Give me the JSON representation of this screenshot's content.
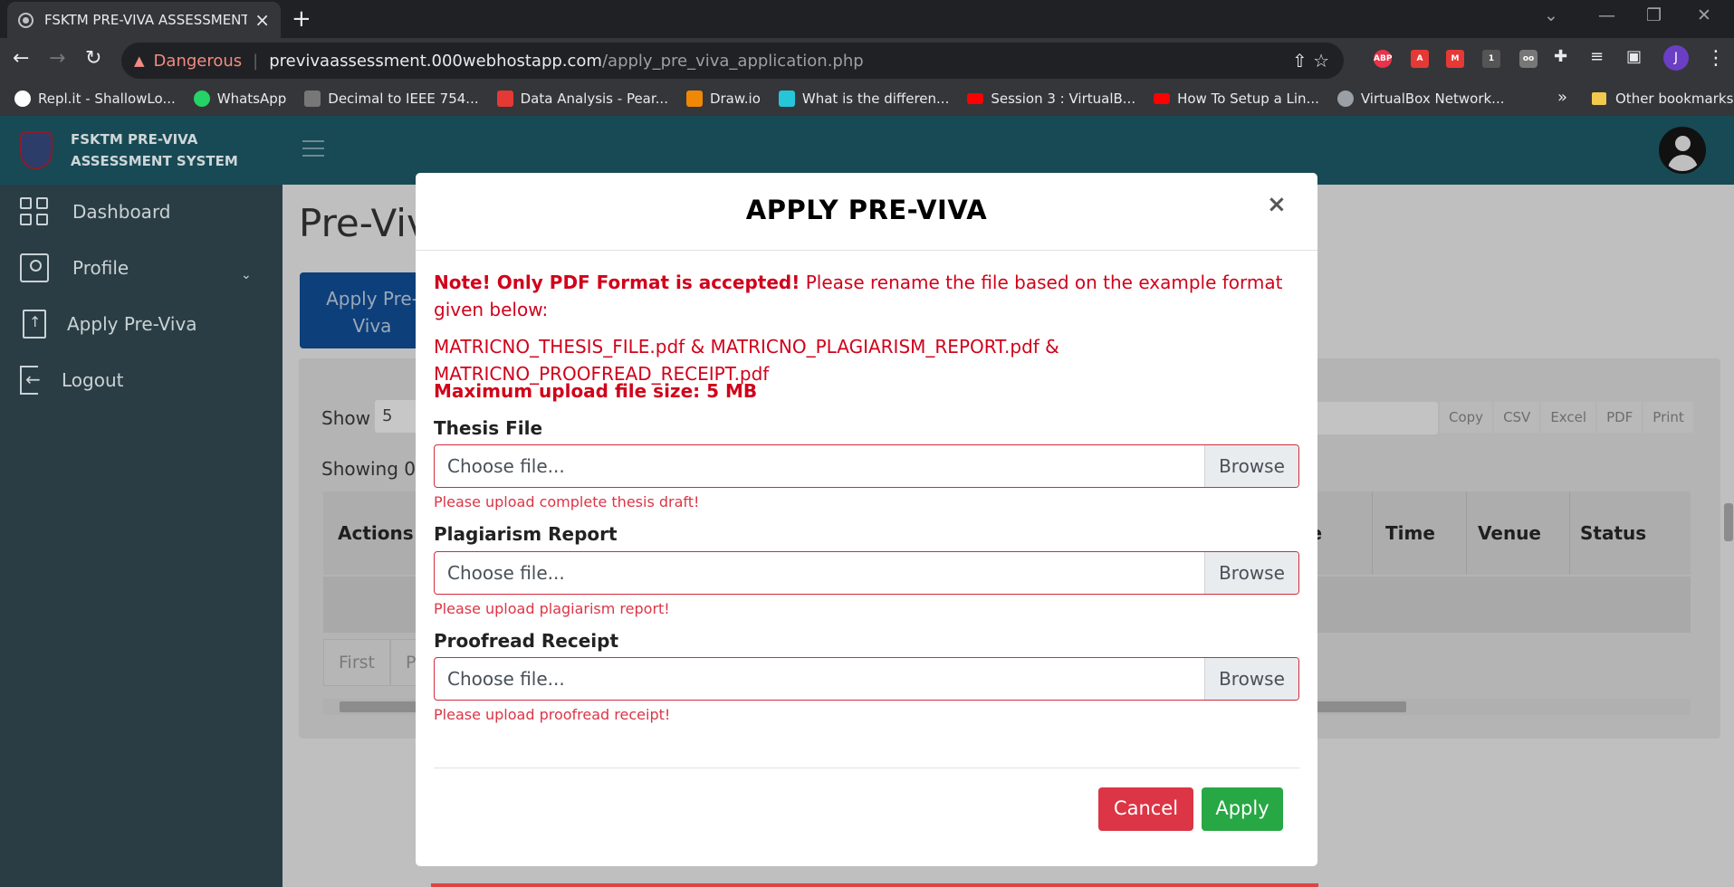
{
  "browser": {
    "tab_title": "FSKTM PRE-VIVA ASSESSMENT S",
    "security_label": "Dangerous",
    "url_host": "previvaassessment.000webhostapp.com",
    "url_path": "/apply_pre_viva_application.php",
    "profile_initial": "J",
    "bookmarks": [
      {
        "label": "Repl.it - ShallowLo...",
        "color": "#ffffff"
      },
      {
        "label": "WhatsApp",
        "color": "#25d366"
      },
      {
        "label": "Decimal to IEEE 754...",
        "color": "#777777"
      },
      {
        "label": "Data Analysis - Pear...",
        "color": "#e53935"
      },
      {
        "label": "Draw.io",
        "color": "#f08705"
      },
      {
        "label": "What is the differen...",
        "color": "#26c6da"
      },
      {
        "label": "Session 3 : VirtualB...",
        "color": "#ff0000"
      },
      {
        "label": "How To Setup a Lin...",
        "color": "#ff0000"
      },
      {
        "label": "VirtualBox Network...",
        "color": "#9aa0a6"
      }
    ],
    "other_bookmarks": "Other bookmarks",
    "extensions": [
      {
        "name": "abp-icon",
        "label": "ABP",
        "color": "#e8334a"
      },
      {
        "name": "pdf-icon",
        "label": "",
        "color": "#e53935"
      },
      {
        "name": "mendeley-icon",
        "label": "",
        "color": "#e53935"
      }
    ]
  },
  "app": {
    "brand_line1": "FSKTM PRE-VIVA",
    "brand_line2": "ASSESSMENT SYSTEM",
    "sidebar": [
      {
        "label": "Dashboard"
      },
      {
        "label": "Profile"
      },
      {
        "label": "Apply Pre-Viva"
      },
      {
        "label": "Logout"
      }
    ],
    "page_title": "Pre-Viv",
    "apply_button_line1": "Apply Pre-",
    "apply_button_line2": "Viva",
    "show_label": "Show",
    "show_value": "5",
    "showing_label": "Showing 0",
    "export_buttons": [
      "Copy",
      "CSV",
      "Excel",
      "PDF",
      "Print"
    ],
    "table_headers": {
      "actions": "Actions",
      "date_fragment": "te",
      "time": "Time",
      "venue": "Venue",
      "status": "Status"
    },
    "pager": [
      "First",
      "Pr"
    ]
  },
  "modal": {
    "title": "APPLY PRE-VIVA",
    "close_symbol": "×",
    "note_bold": "Note! Only PDF Format is accepted!",
    "note_rest": " Please rename the file based on the example format given below:",
    "examples": "MATRICNO_THESIS_FILE.pdf & MATRICNO_PLAGIARISM_REPORT.pdf & MATRICNO_PROOFREAD_RECEIPT.pdf",
    "max_size": "Maximum upload file size: 5 MB",
    "fields": [
      {
        "label": "Thesis File",
        "placeholder": "Choose file...",
        "browse": "Browse",
        "feedback": "Please upload complete thesis draft!"
      },
      {
        "label": "Plagiarism Report",
        "placeholder": "Choose file...",
        "browse": "Browse",
        "feedback": "Please upload plagiarism report!"
      },
      {
        "label": "Proofread Receipt",
        "placeholder": "Choose file...",
        "browse": "Browse",
        "feedback": "Please upload proofread receipt!"
      }
    ],
    "cancel_label": "Cancel",
    "apply_label": "Apply"
  },
  "colors": {
    "navbar": "#174a55",
    "sidebar": "#2b3d44",
    "danger": "#dc3545",
    "success": "#28a745",
    "note_red": "#d0021b"
  }
}
